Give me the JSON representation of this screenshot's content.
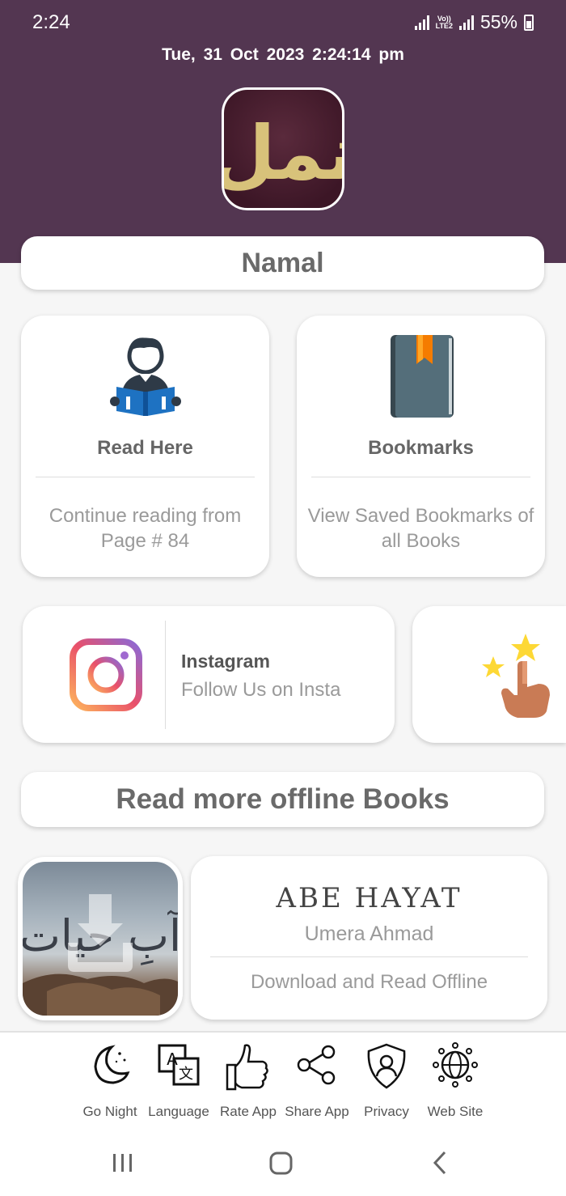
{
  "status_bar": {
    "time": "2:24",
    "network": "Vo)) LTE2",
    "battery": "55%"
  },
  "header": {
    "datetime": "Tue, 31  Oct  2023   2:24:14 pm",
    "logo_text": "نمل"
  },
  "app_title": "Namal",
  "cards": [
    {
      "title": "Read Here",
      "description": "Continue reading from Page # 84",
      "icon": "reader-icon"
    },
    {
      "title": "Bookmarks",
      "description": "View Saved Bookmarks of all Books",
      "icon": "bookmark-book-icon"
    }
  ],
  "social": {
    "title": "Instagram",
    "description": "Follow Us on Insta",
    "icon": "instagram-icon"
  },
  "more_books_heading": "Read more offline Books",
  "book": {
    "title": "ABE HAYAT",
    "author": "Umera Ahmad",
    "action": "Download and Read Offline",
    "cover_text": "آبِ حیات"
  },
  "bottom_menu": [
    {
      "label": "Go Night",
      "icon": "moon-icon"
    },
    {
      "label": "Language",
      "icon": "translate-icon"
    },
    {
      "label": "Rate App",
      "icon": "thumbs-up-icon"
    },
    {
      "label": "Share App",
      "icon": "share-icon"
    },
    {
      "label": "Privacy",
      "icon": "shield-user-icon"
    },
    {
      "label": "Web Site",
      "icon": "globe-icon"
    }
  ],
  "colors": {
    "header": "#533651",
    "logo_gold": "#d8c27a",
    "card_bg": "#ffffff",
    "text_gray": "#6a6a6a"
  }
}
